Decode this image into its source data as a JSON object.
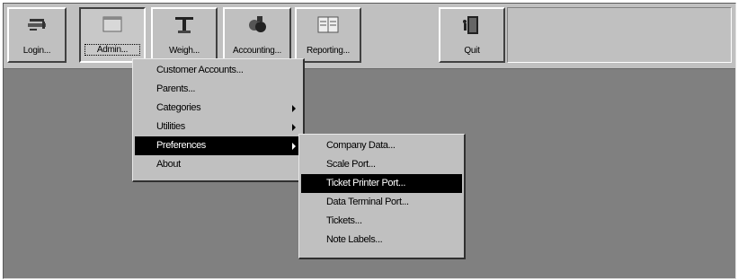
{
  "toolbar": {
    "buttons": [
      {
        "label": "Login...",
        "icon": "key-icon",
        "pressed": false
      },
      {
        "label": "Admin...",
        "icon": "admin-window-icon",
        "pressed": true
      },
      {
        "label": "Weigh...",
        "icon": "scale-icon",
        "pressed": false
      },
      {
        "label": "Accounting...",
        "icon": "accounting-icon",
        "pressed": false
      },
      {
        "label": "Reporting...",
        "icon": "report-icon",
        "pressed": false
      },
      {
        "label": "Quit",
        "icon": "exit-door-icon",
        "pressed": false
      }
    ]
  },
  "admin_menu": {
    "items": [
      {
        "label": "Customer Accounts...",
        "has_submenu": false,
        "highlighted": false
      },
      {
        "label": "Parents...",
        "has_submenu": false,
        "highlighted": false
      },
      {
        "label": "Categories",
        "has_submenu": true,
        "highlighted": false
      },
      {
        "label": "Utilities",
        "has_submenu": true,
        "highlighted": false
      },
      {
        "label": "Preferences",
        "has_submenu": true,
        "highlighted": true
      },
      {
        "label": "About",
        "has_submenu": false,
        "highlighted": false
      }
    ]
  },
  "preferences_menu": {
    "items": [
      {
        "label": "Company Data...",
        "highlighted": false
      },
      {
        "label": "Scale Port...",
        "highlighted": false
      },
      {
        "label": "Ticket Printer Port...",
        "highlighted": true
      },
      {
        "label": "Data Terminal Port...",
        "highlighted": false
      },
      {
        "label": "Tickets...",
        "highlighted": false
      },
      {
        "label": "Note Labels...",
        "highlighted": false
      }
    ]
  },
  "colors": {
    "workspace": "#808080",
    "toolbar": "#c0c0c0",
    "highlight": "#000000"
  }
}
